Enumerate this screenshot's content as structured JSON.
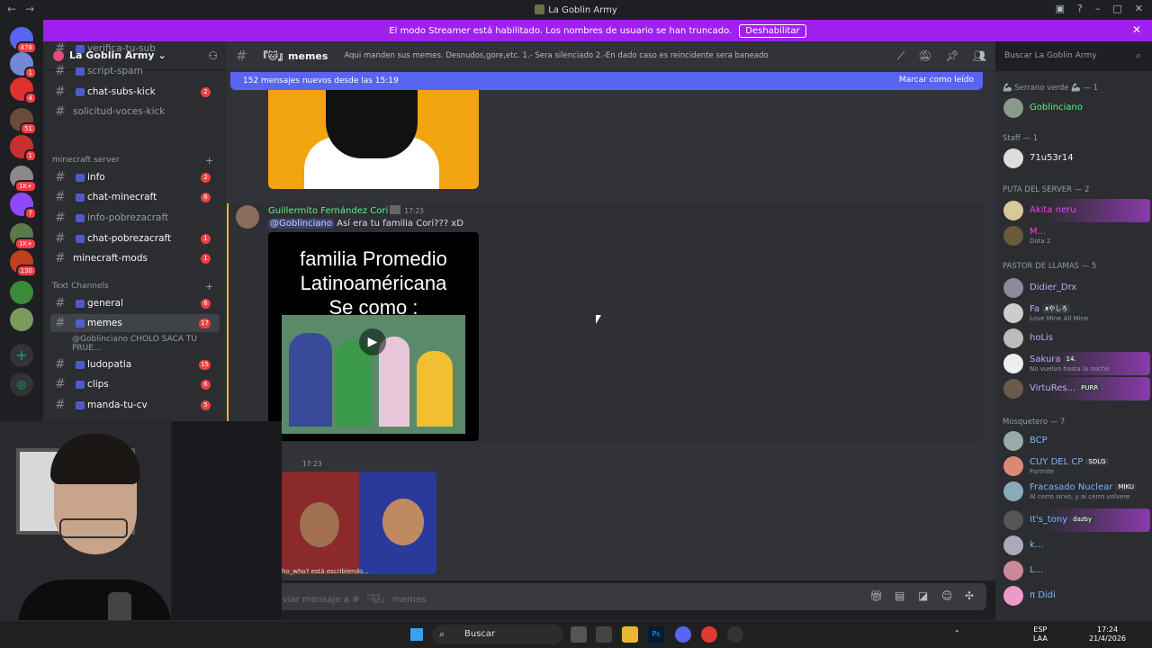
{
  "window": {
    "title": "La Goblin Army",
    "nav_back": "←",
    "nav_forward": "→"
  },
  "banner": {
    "text": "El modo Streamer está habilitado. Los nombres de usuario se han truncado.",
    "button": "Deshabilitar",
    "close": "✕"
  },
  "guilds": [
    {
      "badge": "478",
      "color": "#5865f2"
    },
    {
      "badge": "1",
      "color": "#7289da"
    },
    {
      "badge": "4",
      "color": "#e03030"
    },
    {
      "badge": "51",
      "color": "#6a4a3a"
    },
    {
      "badge": "1",
      "color": "#c83030"
    },
    {
      "badge": "1K+",
      "color": "#8a8a8a"
    },
    {
      "badge": "7",
      "color": "#9146ff"
    },
    {
      "badge": "1K+",
      "color": "#5a7a4a"
    },
    {
      "badge": "130",
      "color": "#c04020"
    },
    {
      "badge": "",
      "color": "#3a8a3a"
    },
    {
      "badge": "",
      "color": "#7a9a5a"
    }
  ],
  "server": {
    "name": "La Goblin Army"
  },
  "channels_top": [
    {
      "name": "verifica-tu-sub",
      "badge": ""
    },
    {
      "name": "script-spam",
      "badge": ""
    },
    {
      "name": "chat-subs-kick",
      "badge": "2"
    },
    {
      "name": "solicitud-voces-kick",
      "badge": ""
    }
  ],
  "cat_minecraft": "minecraft server",
  "channels_mc": [
    {
      "name": "info",
      "badge": "2"
    },
    {
      "name": "chat-minecraft",
      "badge": "6"
    },
    {
      "name": "info-pobrezacraft",
      "badge": ""
    },
    {
      "name": "chat-pobrezacraft",
      "badge": "1"
    },
    {
      "name": "minecraft-mods",
      "badge": "1"
    }
  ],
  "cat_text": "Text Channels",
  "channels_text": [
    {
      "name": "general",
      "badge": "6"
    },
    {
      "name": "memes",
      "badge": "17"
    },
    {
      "name": "@Goblinciano CHOLO SACA TU PRUE...",
      "badge": ""
    },
    {
      "name": "ludopatia",
      "badge": "15"
    },
    {
      "name": "clips",
      "badge": "6"
    },
    {
      "name": "manda-tu-cv",
      "badge": "5"
    }
  ],
  "channel": {
    "name": "memes",
    "topic": "Aqui manden sus memes. Desnudos,gore,etc. 1.- Sera silenciado 2.-En dado caso es reincidente sera baneado"
  },
  "search": {
    "placeholder": "Buscar La Goblin Army"
  },
  "newbar": {
    "text": "152 mensajes nuevos desde las 15:19",
    "mark": "Marcar como leído"
  },
  "message": {
    "author": "Guillermito Fernández Cori",
    "time": "17:23",
    "mention": "@Goblinciano",
    "text": " Así era tu familia Cori??? xD"
  },
  "meme": {
    "line1": "familia Promedio",
    "line2": "Latinoaméricana",
    "line3": "Se como :"
  },
  "message2": {
    "time": "17:23"
  },
  "typing": "ho_who? está escribiendo...",
  "input": {
    "placeholder": "viar mensaje a # 『🐱』 memes"
  },
  "members": {
    "groups": [
      {
        "title": "🦾 Serrano verde 🦾 — 1"
      },
      {
        "title": "Staff — 1"
      },
      {
        "title": "PUTA DEL SERVER — 2"
      },
      {
        "title": "PASTOR DE LLAMAS — 5"
      },
      {
        "title": "Mosquetero — 7"
      }
    ],
    "list": [
      {
        "name": "Goblinciano",
        "status": "",
        "color": "#57f287",
        "pill": ""
      },
      {
        "name": "71u53r14",
        "status": "",
        "color": "#f2f3f5",
        "pill": ""
      },
      {
        "name": "Akita neru",
        "status": "",
        "color": "#ff3af0",
        "pill": ""
      },
      {
        "name": "M...",
        "status": "Dota 2",
        "color": "#ff3af0",
        "pill": ""
      },
      {
        "name": "Didier_Drx",
        "status": "",
        "color": "#c9a3ff",
        "pill": ""
      },
      {
        "name": "Fa",
        "status": "Love Mine All Mine",
        "color": "#c9a3ff",
        "pill": "ᴥやしろ"
      },
      {
        "name": "hoLis",
        "status": "",
        "color": "#c9a3ff",
        "pill": ""
      },
      {
        "name": "Sakura",
        "status": "No vuelvo hasta la noche",
        "color": "#c9a3ff",
        "pill": "14."
      },
      {
        "name": "VirtuRes...",
        "status": "",
        "color": "#c9a3ff",
        "pill": "PURR"
      },
      {
        "name": "BCP",
        "status": "",
        "color": "#7cb3ff",
        "pill": ""
      },
      {
        "name": "CUY DEL CP",
        "status": "Fortnite",
        "color": "#7cb3ff",
        "pill": "SDLG"
      },
      {
        "name": "Fracasado Nuclear",
        "status": "Al cerro sirvo, y al cerro volvere",
        "color": "#7cb3ff",
        "pill": "MIKU"
      },
      {
        "name": "It's_tony",
        "status": "",
        "color": "#7cb3ff",
        "pill": "dazby"
      },
      {
        "name": "k...",
        "status": "",
        "color": "#7cb3ff",
        "pill": ""
      },
      {
        "name": "L...",
        "status": "",
        "color": "#7cb3ff",
        "pill": ""
      },
      {
        "name": "π Didi",
        "status": "",
        "color": "#7cb3ff",
        "pill": ""
      }
    ]
  },
  "taskbar": {
    "search": "Buscar",
    "lang1": "ESP",
    "lang2": "LAA",
    "clock": "17:24",
    "date": "21/4/2026"
  }
}
